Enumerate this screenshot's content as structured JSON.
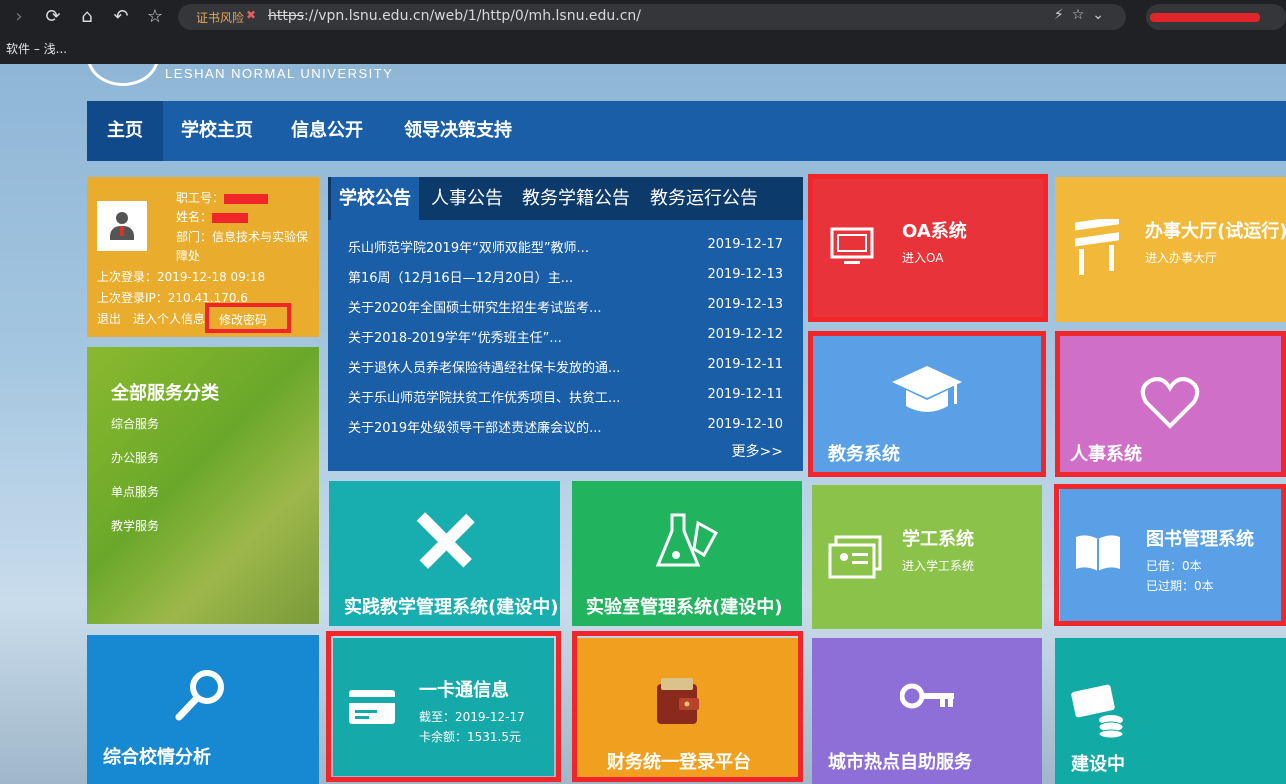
{
  "browser": {
    "cert_warning": "证书风险",
    "url_protocol": "https",
    "url_rest": "://vpn.lsnu.edu.cn/web/1/http/0/mh.lsnu.edu.cn/",
    "bookmark": "软件 – 浅..."
  },
  "brand": {
    "english": "LESHAN NORMAL UNIVERSITY"
  },
  "nav": {
    "items": [
      "主页",
      "学校主页",
      "信息公开",
      "领导决策支持"
    ]
  },
  "user": {
    "id_label": "职工号：",
    "name_label": "姓名：",
    "dept": "部门：信息技术与实验保",
    "dept2": "障处",
    "last_login": "上次登录：2019-12-18 09:18",
    "last_ip": "上次登录IP：210.41.170.6",
    "logout": "退出",
    "personal": "进入个人信息",
    "change_password": "修改密码"
  },
  "services": {
    "title": "全部服务分类",
    "items": [
      "综合服务",
      "办公服务",
      "单点服务",
      "教学服务"
    ]
  },
  "notices": {
    "tabs": [
      "学校公告",
      "人事公告",
      "教务学籍公告",
      "教务运行公告"
    ],
    "rows": [
      {
        "title": "乐山师范学院2019年“双师双能型”教师...",
        "date": "2019-12-17"
      },
      {
        "title": "第16周（12月16日—12月20日）主...",
        "date": "2019-12-13"
      },
      {
        "title": "关于2020年全国硕士研究生招生考试监考...",
        "date": "2019-12-13"
      },
      {
        "title": "关于2018-2019学年“优秀班主任”...",
        "date": "2019-12-12"
      },
      {
        "title": "关于退休人员养老保险待遇经社保卡发放的通...",
        "date": "2019-12-11"
      },
      {
        "title": "关于乐山师范学院扶贫工作优秀项目、扶贫工...",
        "date": "2019-12-11"
      },
      {
        "title": "关于2019年处级领导干部述责述廉会议的...",
        "date": "2019-12-10"
      }
    ],
    "more": "更多>>"
  },
  "tiles": {
    "oa": {
      "title": "OA系统",
      "sub": "进入OA"
    },
    "hall": {
      "title": "办事大厅(试运行)",
      "sub": "进入办事大厅"
    },
    "jiaowu": {
      "title": "教务系统"
    },
    "renshi": {
      "title": "人事系统"
    },
    "shijian": {
      "title": "实践教学管理系统(建设中)"
    },
    "shiyan": {
      "title": "实验室管理系统(建设中)"
    },
    "xuegong": {
      "title": "学工系统",
      "sub": "进入学工系统"
    },
    "library": {
      "title": "图书管理系统",
      "borrowed": "已借：0本",
      "overdue": "已过期：0本"
    },
    "analysis": {
      "title": "综合校情分析"
    },
    "card": {
      "title": "一卡通信息",
      "until": "截至：2019-12-17",
      "balance": "卡余额：1531.5元"
    },
    "finance": {
      "title": "财务统一登录平台"
    },
    "city": {
      "title": "城市热点自助服务"
    },
    "build": {
      "title": "建设中"
    }
  },
  "colors": {
    "nav": "#1b5ea8",
    "oa": "#e8333a",
    "hall": "#f2b83a",
    "jiaowu": "#5aa0e6",
    "renshi": "#cf6fc8",
    "shijian": "#18aeb0",
    "shiyan": "#22b35e",
    "xuegong": "#8bc34a",
    "library": "#5aa0e6",
    "analysis": "#1789d3",
    "card": "#16a9a9",
    "finance": "#f0a01e",
    "city": "#8e6fd8",
    "build": "#12aaa4",
    "highlight": "#f0262b"
  }
}
